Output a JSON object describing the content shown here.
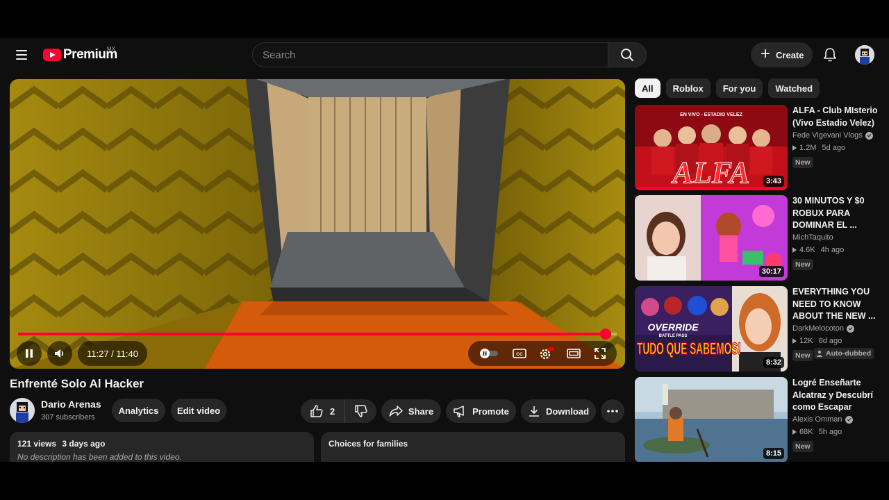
{
  "header": {
    "logo_text": "Premium",
    "region": "MX",
    "search_placeholder": "Search",
    "create_label": "Create"
  },
  "player": {
    "time": "11:27 / 11:40",
    "progress": 0.982
  },
  "video": {
    "title": "Enfrenté Solo Al Hacker",
    "channel_name": "Dario Arenas",
    "subscribers": "307 subscribers",
    "analytics_label": "Analytics",
    "edit_label": "Edit video",
    "like_count": "2",
    "share_label": "Share",
    "promote_label": "Promote",
    "download_label": "Download",
    "views": "121 views",
    "date": "3 days ago",
    "description_empty": "No description has been added to this video.",
    "families_title": "Choices for families"
  },
  "chips": [
    "All",
    "Roblox",
    "For you",
    "Watched"
  ],
  "recommendations": [
    {
      "title": "ALFA - Club MIsterio (Vivo Estadio Velez)",
      "channel": "Fede Vigevani Vlogs",
      "verified": true,
      "views": "1.2M",
      "age": "5d ago",
      "badge": "New",
      "duration": "3:43",
      "thumb_text": "ALFA",
      "thumb_top_text": "EN VIVO - ESTADIO VELEZ"
    },
    {
      "title": "30 MINUTOS Y $0 ROBUX PARA DOMINAR EL ...",
      "channel": "MichTaquito",
      "verified": false,
      "views": "4.6K",
      "age": "4h ago",
      "badge": "New",
      "duration": "30:17"
    },
    {
      "title": "EVERYTHING YOU NEED TO KNOW ABOUT THE NEW ...",
      "channel": "DarkMelocoton",
      "verified": true,
      "views": "12K",
      "age": "6d ago",
      "badge": "New",
      "badge2": "Auto-dubbed",
      "duration": "8:32",
      "thumb_text": "TUDO QUE SABEMOS!",
      "thumb_top_text": "OVERRIDE",
      "thumb_sub_text": "BATTLE PASS"
    },
    {
      "title": "Logré Enseñarte Alcatraz y Descubrí como Escapar",
      "channel": "Alexis Omman",
      "verified": true,
      "views": "68K",
      "age": "5h ago",
      "badge": "New",
      "duration": "8:15"
    }
  ],
  "colors": {
    "brand_red": "#ff0033",
    "background": "#0f0f0f",
    "surface": "#272727"
  }
}
